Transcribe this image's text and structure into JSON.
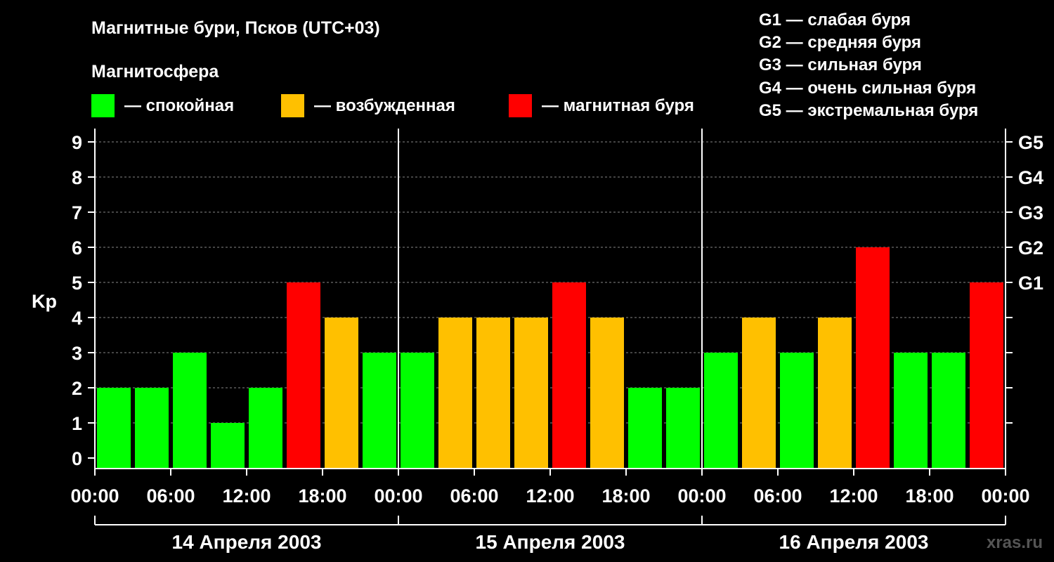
{
  "title": "Магнитные бури, Псков (UTC+03)",
  "legend": {
    "heading": "Магнитосфера",
    "items": [
      {
        "label": "— спокойная",
        "color": "#00ff00"
      },
      {
        "label": "— возбужденная",
        "color": "#ffc000"
      },
      {
        "label": "— магнитная буря",
        "color": "#ff0000"
      }
    ]
  },
  "g_scale": [
    "G1 — слабая буря",
    "G2 — средняя буря",
    "G3 — сильная буря",
    "G4 — очень сильная буря",
    "G5 — экстремальная буря"
  ],
  "watermark": "xras.ru",
  "chart_data": {
    "type": "bar",
    "ylabel": "Kp",
    "ylim": [
      0,
      9
    ],
    "yticks": [
      "0",
      "1",
      "2",
      "3",
      "4",
      "5",
      "6",
      "7",
      "8",
      "9"
    ],
    "right_ticks": [
      {
        "kp": 5,
        "label": "G1"
      },
      {
        "kp": 6,
        "label": "G2"
      },
      {
        "kp": 7,
        "label": "G3"
      },
      {
        "kp": 8,
        "label": "G4"
      },
      {
        "kp": 9,
        "label": "G5"
      }
    ],
    "grid": true,
    "xticks": [
      "00:00",
      "06:00",
      "12:00",
      "18:00",
      "00:00",
      "06:00",
      "12:00",
      "18:00",
      "00:00",
      "06:00",
      "12:00",
      "18:00",
      "00:00"
    ],
    "days": [
      "14 Апреля 2003",
      "15 Апреля 2003",
      "16 Апреля 2003"
    ],
    "interval_hours": 3,
    "values": [
      2,
      2,
      3,
      1,
      2,
      5,
      4,
      3,
      3,
      4,
      4,
      4,
      5,
      4,
      2,
      2,
      3,
      4,
      3,
      4,
      6,
      3,
      3,
      5
    ],
    "colors": {
      "quiet": "#00ff00",
      "active": "#ffc000",
      "storm": "#ff0000"
    }
  }
}
